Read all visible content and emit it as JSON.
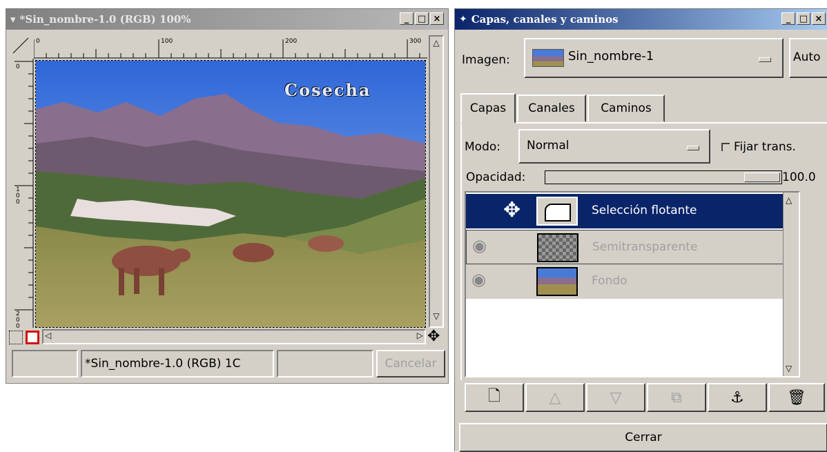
{
  "image_window": {
    "title": "*Sin_nombre-1.0 (RGB) 100%",
    "ruler_top_labels": [
      "0",
      "100",
      "200",
      "300"
    ],
    "ruler_left_labels": [
      "0",
      "100",
      "200"
    ],
    "canvas_text": "Cosecha",
    "status_title": "*Sin_nombre-1.0 (RGB) 1C",
    "cancel_label": "Cancelar"
  },
  "layers_dialog": {
    "title": "Capas, canales y caminos",
    "image_label": "Imagen:",
    "image_value": "Sin_nombre-1",
    "auto_label": "Auto",
    "tabs": [
      "Capas",
      "Canales",
      "Caminos"
    ],
    "mode_label": "Modo:",
    "mode_value": "Normal",
    "keep_trans_label": "Fijar trans.",
    "opacity_label": "Opacidad:",
    "opacity_value": "100.0",
    "opacity_fraction": 1.0,
    "layers": [
      {
        "name": "Selección flotante",
        "selected": true,
        "icon": "move-icon"
      },
      {
        "name": "Semitransparente",
        "selected": false,
        "icon": "eye-icon"
      },
      {
        "name": "Fondo",
        "selected": false,
        "icon": "eye-icon"
      }
    ],
    "toolbar_icons": [
      "new-layer-icon",
      "raise-layer-icon",
      "lower-layer-icon",
      "duplicate-layer-icon",
      "anchor-icon",
      "delete-icon"
    ],
    "close_label": "Cerrar"
  },
  "colors": {
    "selection": "#0a246a",
    "window_bg": "#d4d0c8"
  }
}
